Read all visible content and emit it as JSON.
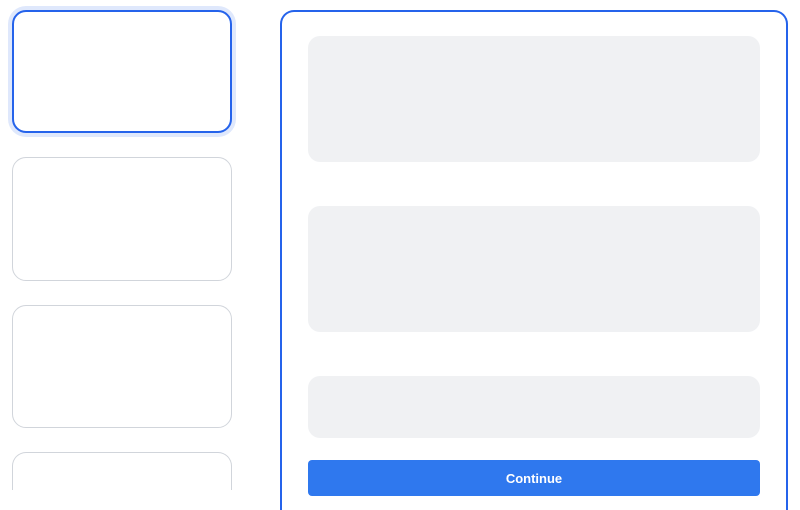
{
  "sidebar": {
    "thumbnails": [
      {
        "selected": true
      },
      {
        "selected": false
      },
      {
        "selected": false
      },
      {
        "selected": false
      }
    ]
  },
  "main": {
    "continue_label": "Continue"
  }
}
